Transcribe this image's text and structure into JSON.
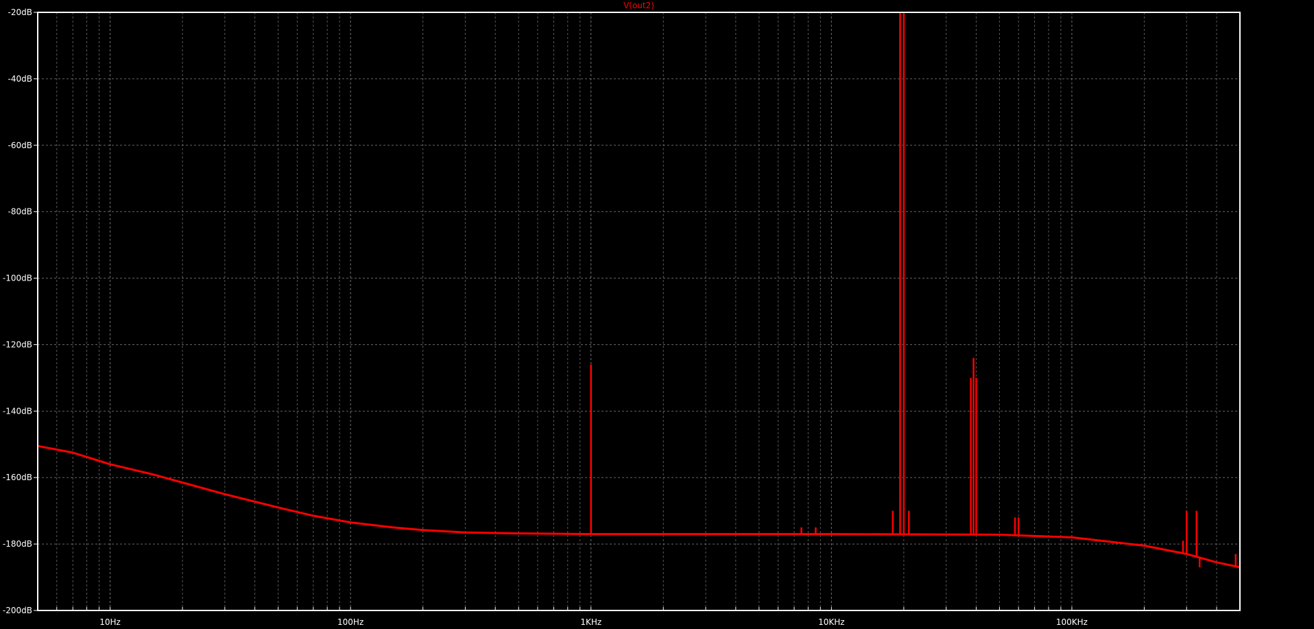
{
  "chart_data": {
    "type": "line",
    "title": "V(out2)",
    "xlabel": "",
    "ylabel": "",
    "x_scale": "log",
    "xlim": [
      5,
      500000
    ],
    "ylim": [
      -200,
      -20
    ],
    "grid": true,
    "background": "#000000",
    "trace_color": "#ff0000",
    "axis_color": "#ffffff",
    "grid_color": "#808080",
    "x_ticks": [
      {
        "value": 10,
        "label": "10Hz"
      },
      {
        "value": 100,
        "label": "100Hz"
      },
      {
        "value": 1000,
        "label": "1KHz"
      },
      {
        "value": 10000,
        "label": "10KHz"
      },
      {
        "value": 100000,
        "label": "100KHz"
      }
    ],
    "y_ticks": [
      {
        "value": -20,
        "label": "-20dB"
      },
      {
        "value": -40,
        "label": "-40dB"
      },
      {
        "value": -60,
        "label": "-60dB"
      },
      {
        "value": -80,
        "label": "-80dB"
      },
      {
        "value": -100,
        "label": "-100dB"
      },
      {
        "value": -120,
        "label": "-120dB"
      },
      {
        "value": -140,
        "label": "-140dB"
      },
      {
        "value": -160,
        "label": "-160dB"
      },
      {
        "value": -180,
        "label": "-180dB"
      },
      {
        "value": -200,
        "label": "-200dB"
      }
    ],
    "series": [
      {
        "color": "#ff0000",
        "noise_floor": [
          {
            "x": 5,
            "y": -150.5
          },
          {
            "x": 7,
            "y": -152.5
          },
          {
            "x": 10,
            "y": -156
          },
          {
            "x": 15,
            "y": -159
          },
          {
            "x": 20,
            "y": -161.5
          },
          {
            "x": 30,
            "y": -165
          },
          {
            "x": 50,
            "y": -169
          },
          {
            "x": 70,
            "y": -171.5
          },
          {
            "x": 100,
            "y": -173.5
          },
          {
            "x": 150,
            "y": -175
          },
          {
            "x": 200,
            "y": -175.8
          },
          {
            "x": 300,
            "y": -176.5
          },
          {
            "x": 500,
            "y": -176.8
          },
          {
            "x": 1000,
            "y": -177
          },
          {
            "x": 10000,
            "y": -177
          },
          {
            "x": 50000,
            "y": -177.2
          },
          {
            "x": 100000,
            "y": -178
          },
          {
            "x": 200000,
            "y": -180.5
          },
          {
            "x": 300000,
            "y": -183
          },
          {
            "x": 400000,
            "y": -185.5
          },
          {
            "x": 500000,
            "y": -187
          }
        ],
        "spikes": [
          {
            "x": 1000,
            "y": -126
          },
          {
            "x": 18000,
            "y": -170
          },
          {
            "x": 19300,
            "y": -20
          },
          {
            "x": 20000,
            "y": -20
          },
          {
            "x": 21000,
            "y": -170
          },
          {
            "x": 7500,
            "y": -175
          },
          {
            "x": 8600,
            "y": -175
          },
          {
            "x": 38000,
            "y": -130
          },
          {
            "x": 39000,
            "y": -124
          },
          {
            "x": 40000,
            "y": -130
          },
          {
            "x": 58000,
            "y": -172
          },
          {
            "x": 60000,
            "y": -172
          },
          {
            "x": 290000,
            "y": -179
          },
          {
            "x": 300000,
            "y": -170
          },
          {
            "x": 330000,
            "y": -170
          },
          {
            "x": 340000,
            "y": -187
          },
          {
            "x": 480000,
            "y": -183
          }
        ]
      }
    ]
  }
}
